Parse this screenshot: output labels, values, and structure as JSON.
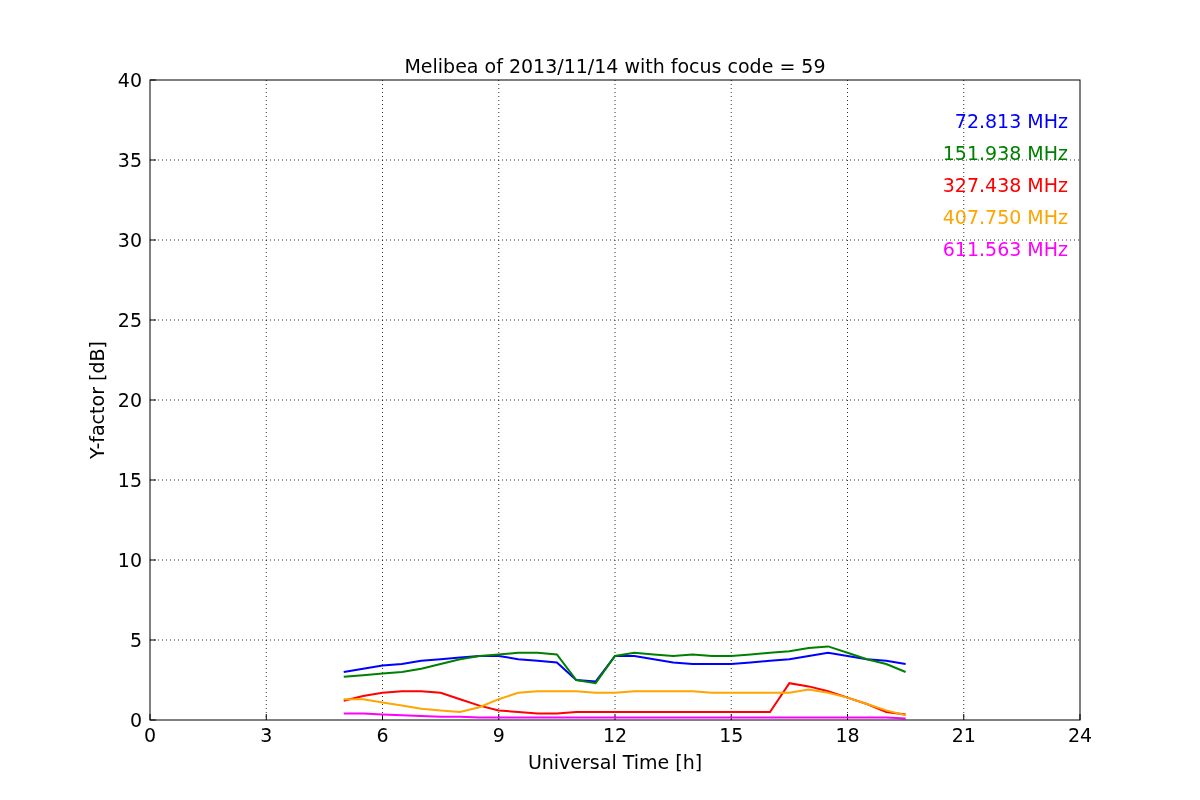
{
  "chart_data": {
    "type": "line",
    "title": "Melibea of 2013/11/14 with focus code = 59",
    "xlabel": "Universal Time [h]",
    "ylabel": "Y-factor [dB]",
    "x": [
      5,
      5.5,
      6,
      6.5,
      7,
      7.5,
      8,
      8.5,
      9,
      9.5,
      10,
      10.5,
      11,
      11.5,
      12,
      12.5,
      13,
      13.5,
      14,
      14.5,
      15,
      15.5,
      16,
      16.5,
      17,
      17.5,
      18,
      18.5,
      19,
      19.5
    ],
    "series": [
      {
        "name": "72.813 MHz",
        "color": "#0000ff",
        "values": [
          3.0,
          3.2,
          3.4,
          3.5,
          3.7,
          3.8,
          3.9,
          4.0,
          4.0,
          3.8,
          3.7,
          3.6,
          2.5,
          2.4,
          4.0,
          4.0,
          3.8,
          3.6,
          3.5,
          3.5,
          3.5,
          3.6,
          3.7,
          3.8,
          4.0,
          4.2,
          4.0,
          3.8,
          3.7,
          3.5
        ]
      },
      {
        "name": "151.938 MHz",
        "color": "#008000",
        "values": [
          2.7,
          2.8,
          2.9,
          3.0,
          3.2,
          3.5,
          3.8,
          4.0,
          4.1,
          4.2,
          4.2,
          4.1,
          2.5,
          2.3,
          4.0,
          4.2,
          4.1,
          4.0,
          4.1,
          4.0,
          4.0,
          4.1,
          4.2,
          4.3,
          4.5,
          4.6,
          4.2,
          3.8,
          3.5,
          3.0
        ]
      },
      {
        "name": "327.438 MHz",
        "color": "#ff0000",
        "values": [
          1.2,
          1.5,
          1.7,
          1.8,
          1.8,
          1.7,
          1.3,
          0.9,
          0.6,
          0.5,
          0.4,
          0.4,
          0.5,
          0.5,
          0.5,
          0.5,
          0.5,
          0.5,
          0.5,
          0.5,
          0.5,
          0.5,
          0.5,
          2.3,
          2.1,
          1.8,
          1.4,
          1.0,
          0.5,
          0.35
        ]
      },
      {
        "name": "407.750 MHz",
        "color": "#ffa500",
        "values": [
          1.3,
          1.3,
          1.1,
          0.9,
          0.7,
          0.6,
          0.5,
          0.8,
          1.3,
          1.7,
          1.8,
          1.8,
          1.8,
          1.7,
          1.7,
          1.8,
          1.8,
          1.8,
          1.8,
          1.7,
          1.7,
          1.7,
          1.7,
          1.7,
          1.9,
          1.7,
          1.4,
          1.0,
          0.6,
          0.3
        ]
      },
      {
        "name": "611.563 MHz",
        "color": "#ff00ff",
        "values": [
          0.4,
          0.4,
          0.35,
          0.3,
          0.25,
          0.2,
          0.2,
          0.15,
          0.15,
          0.15,
          0.15,
          0.15,
          0.15,
          0.15,
          0.15,
          0.15,
          0.15,
          0.15,
          0.15,
          0.15,
          0.15,
          0.15,
          0.15,
          0.15,
          0.15,
          0.15,
          0.15,
          0.15,
          0.15,
          0.1
        ]
      }
    ],
    "grid": true,
    "xlim": [
      0,
      24
    ],
    "ylim": [
      0,
      40
    ],
    "xticks": [
      0,
      3,
      6,
      9,
      12,
      15,
      18,
      21,
      24
    ],
    "yticks": [
      0,
      5,
      10,
      15,
      20,
      25,
      30,
      35,
      40
    ]
  }
}
